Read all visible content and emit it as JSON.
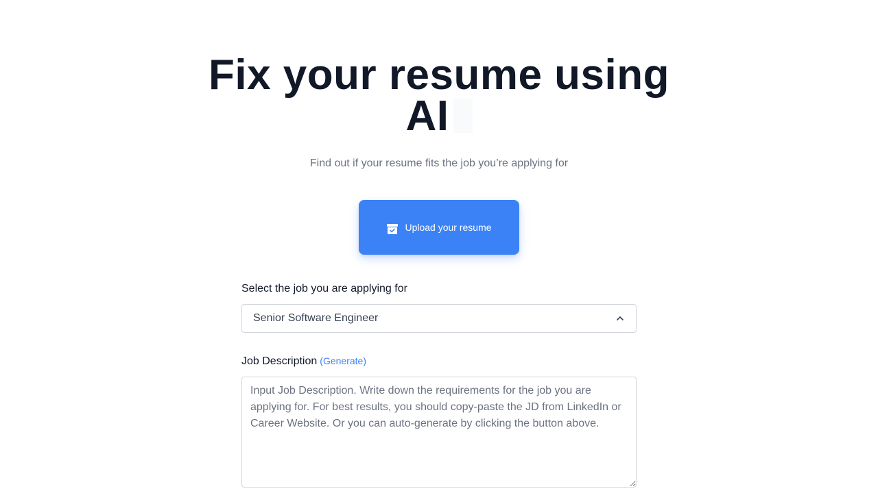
{
  "hero": {
    "title_line1": "Fix your resume using",
    "title_line2": "AI",
    "subtitle": "Find out if your resume fits the job you’re applying for"
  },
  "upload": {
    "label": "Upload your resume",
    "icon": "archive-box-icon"
  },
  "job_select": {
    "label": "Select the job you are applying for",
    "selected_value": "Senior Software Engineer",
    "icon": "chevron-up-icon"
  },
  "job_description": {
    "label": "Job Description",
    "generate_label": "(Generate)",
    "placeholder": "Input Job Description. Write down the requirements for the job you are applying for. For best results, you should copy-paste the JD from LinkedIn or Career Website. Or you can auto-generate by clicking the button above.",
    "value": ""
  },
  "colors": {
    "accent": "#3b82f6",
    "title": "#111827",
    "muted": "#6b7280",
    "border": "#d1d5db"
  }
}
